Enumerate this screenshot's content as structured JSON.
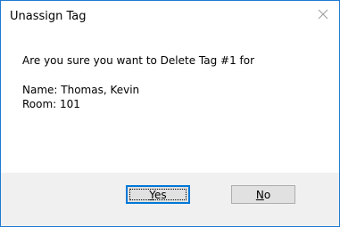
{
  "dialog": {
    "title": "Unassign Tag",
    "close_icon": "close-icon",
    "message": {
      "question": "Are you sure you want to Delete Tag #1 for",
      "name_line": "Name: Thomas, Kevin",
      "room_line": "Room: 101"
    },
    "buttons": {
      "yes": {
        "accel": "Y",
        "rest": "es"
      },
      "no": {
        "accel": "N",
        "rest": "o"
      }
    }
  },
  "colors": {
    "border": "#1f7ad1",
    "footer_bg": "#f0f0f0",
    "button_bg": "#e1e1e1",
    "default_button_border": "#0078d7"
  }
}
